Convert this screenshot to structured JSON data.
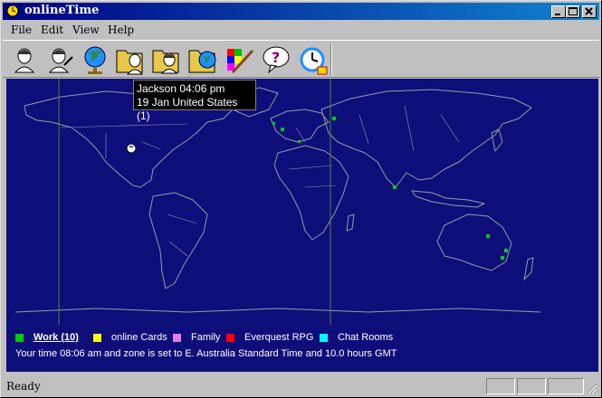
{
  "window": {
    "title": "onlineTime"
  },
  "menu": {
    "file": "File",
    "edit": "Edit",
    "view": "View",
    "help": "Help"
  },
  "toolbar": {
    "buttons": [
      {
        "icon": "person-icon"
      },
      {
        "icon": "person-edit-icon"
      },
      {
        "icon": "globe-icon"
      },
      {
        "icon": "folder-person-icon"
      },
      {
        "icon": "folder-people-icon"
      },
      {
        "icon": "folder-edit-icon"
      },
      {
        "icon": "folder-globe-icon"
      },
      {
        "icon": "palette-icon"
      },
      {
        "icon": "help-bubble-icon"
      },
      {
        "icon": "alarm-clock-icon"
      }
    ]
  },
  "tooltip": {
    "line1": "Jackson 04:06 pm",
    "line2": "19 Jan United States (1)"
  },
  "legend": [
    {
      "label": "Work (10)",
      "color": "#00d000",
      "active": true
    },
    {
      "label": "online Cards",
      "color": "#ffff00",
      "active": false
    },
    {
      "label": "Family",
      "color": "#e080e0",
      "active": false
    },
    {
      "label": "Everquest RPG",
      "color": "#ff0000",
      "active": false
    },
    {
      "label": "Chat Rooms",
      "color": "#00ffff",
      "active": false
    }
  ],
  "time_info": "Your time 08:06 am and zone is set to E. Australia Standard Time and 10.0 hours GMT",
  "status": {
    "text": "Ready"
  },
  "colors": {
    "map_bg": "#0e0e7a",
    "land_outline": "#8aa0a0",
    "marker": "#00d000",
    "terminator": "#3a8a3a"
  }
}
